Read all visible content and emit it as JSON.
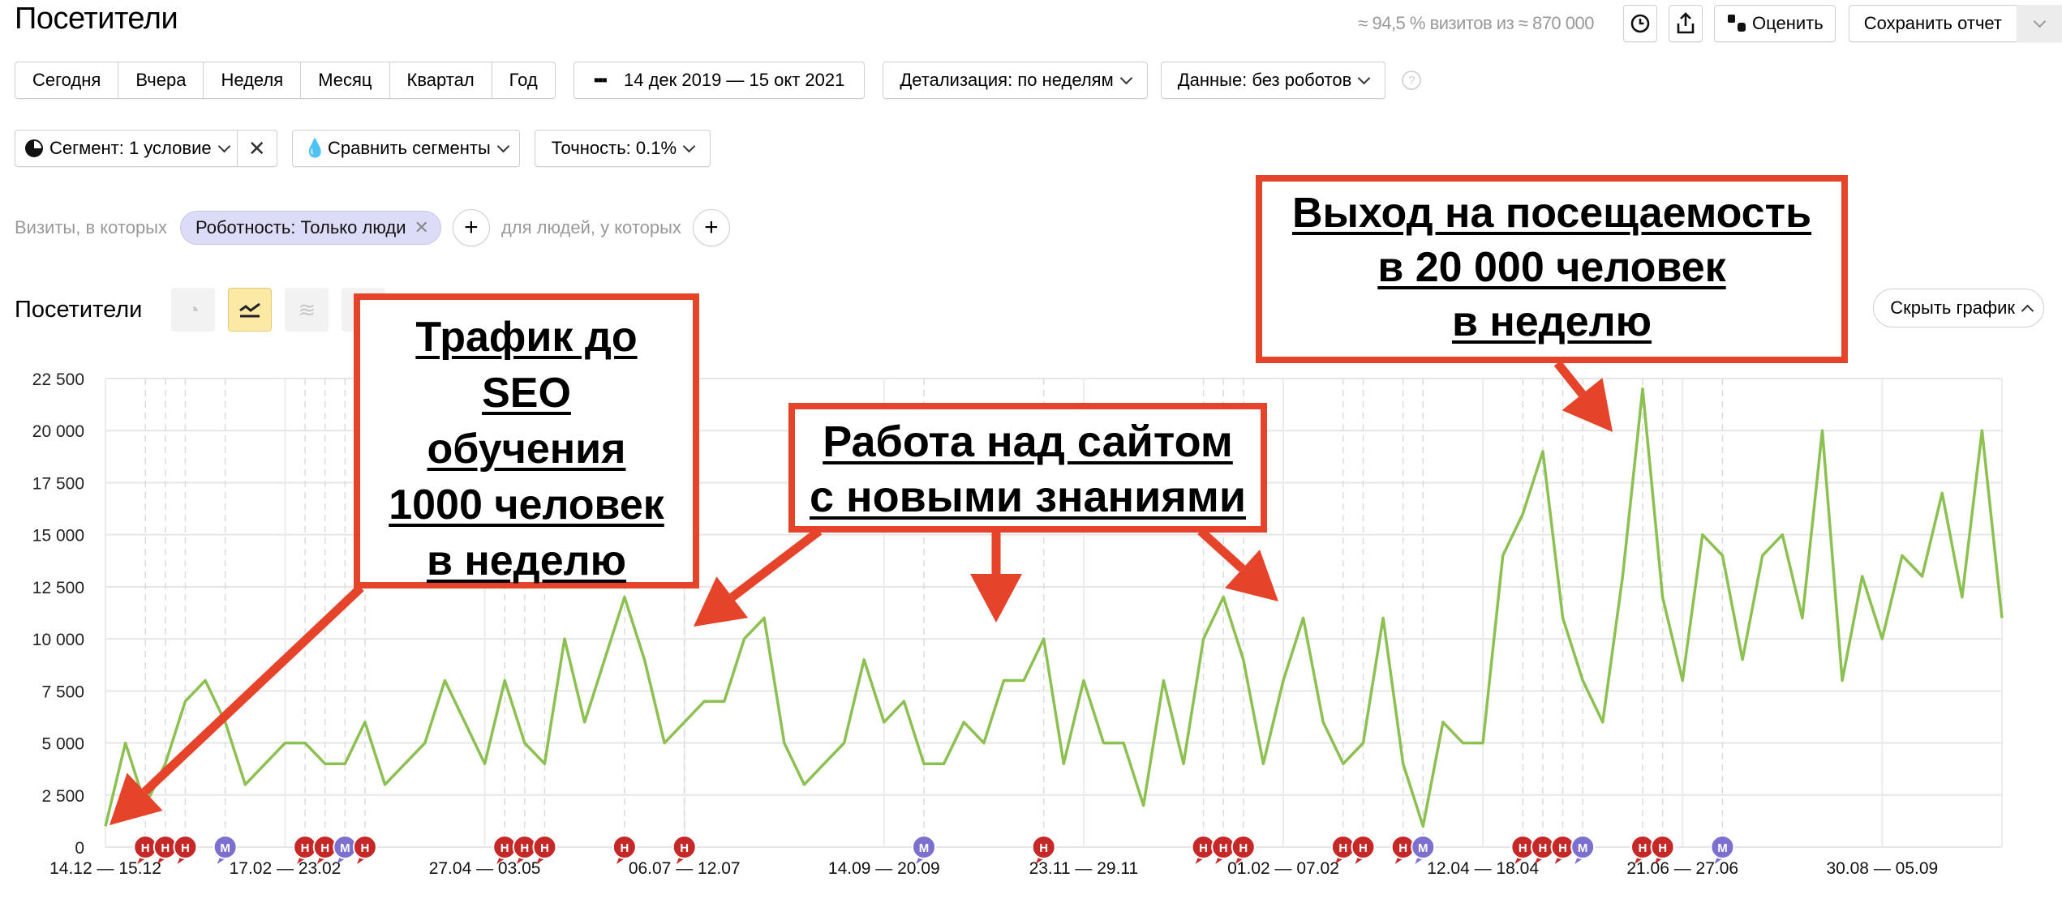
{
  "header": {
    "title": "Посетители",
    "sampling_text": "≈ 94,5 % визитов из ≈ 870 000",
    "rate_label": "Оценить",
    "save_label": "Сохранить отчет"
  },
  "periods": [
    "Сегодня",
    "Вчера",
    "Неделя",
    "Месяц",
    "Квартал",
    "Год"
  ],
  "date_range": "14 дек 2019 — 15 окт 2021",
  "detail_label": "Детализация: по неделям",
  "data_label": "Данные: без роботов",
  "segment": {
    "label": "Сегмент: 1 условие",
    "compare_label": "Сравнить сегменты",
    "accuracy_label": "Точность: 0.1%"
  },
  "filters": {
    "visits_prefix": "Визиты, в которых",
    "chip_label": "Роботность: Только люди",
    "people_prefix": "для людей, у которых"
  },
  "chart_section": {
    "title": "Посетители",
    "hide_label": "Скрыть график"
  },
  "annotations": [
    {
      "lines": [
        "Трафик до",
        "SEO",
        "обучения",
        "1000 человек",
        "в неделю"
      ]
    },
    {
      "lines": [
        "Работа над сайтом",
        "с новыми знаниями"
      ]
    },
    {
      "lines": [
        "Выход на посещаемость",
        "в 20 000 человек",
        "в неделю"
      ]
    }
  ],
  "colors": {
    "line": "#8cc152",
    "annotation": "#e5432a",
    "marker_h": "#c62828",
    "marker_m": "#7b6fcf"
  },
  "chart_data": {
    "type": "line",
    "title": "Посетители",
    "xlabel": "",
    "ylabel": "",
    "ylim": [
      0,
      22500
    ],
    "yticks": [
      0,
      2500,
      5000,
      7500,
      10000,
      12500,
      15000,
      17500,
      20000,
      22500
    ],
    "ytick_labels": [
      "0",
      "2 500",
      "5 000",
      "7 500",
      "10 000",
      "12 500",
      "15 000",
      "17 500",
      "20 000",
      "22 500"
    ],
    "x_tick_labels": [
      {
        "index": 0,
        "label": "14.12 — 15.12"
      },
      {
        "index": 9,
        "label": "17.02 — 23.02"
      },
      {
        "index": 19,
        "label": "27.04 — 03.05"
      },
      {
        "index": 29,
        "label": "06.07 — 12.07"
      },
      {
        "index": 39,
        "label": "14.09 — 20.09"
      },
      {
        "index": 49,
        "label": "23.11 — 29.11"
      },
      {
        "index": 59,
        "label": "01.02 — 07.02"
      },
      {
        "index": 69,
        "label": "12.04 — 18.04"
      },
      {
        "index": 79,
        "label": "21.06 — 27.06"
      },
      {
        "index": 89,
        "label": "30.08 — 05.09"
      }
    ],
    "grid": true,
    "legend": "none",
    "series": [
      {
        "name": "Посетители",
        "values": [
          1000,
          5000,
          2000,
          4000,
          7000,
          8000,
          6000,
          3000,
          4000,
          5000,
          5000,
          4000,
          4000,
          6000,
          3000,
          4000,
          5000,
          8000,
          6000,
          4000,
          8000,
          5000,
          4000,
          10000,
          6000,
          9000,
          12000,
          9000,
          5000,
          6000,
          7000,
          7000,
          10000,
          11000,
          5000,
          3000,
          4000,
          5000,
          9000,
          6000,
          7000,
          4000,
          4000,
          6000,
          5000,
          8000,
          8000,
          10000,
          4000,
          8000,
          5000,
          5000,
          2000,
          8000,
          4000,
          10000,
          12000,
          9000,
          4000,
          8000,
          11000,
          6000,
          4000,
          5000,
          11000,
          4000,
          1000,
          6000,
          5000,
          5000,
          14000,
          16000,
          19000,
          11000,
          8000,
          6000,
          13000,
          22000,
          12000,
          8000,
          15000,
          14000,
          9000,
          14000,
          15000,
          11000,
          20000,
          8000,
          13000,
          10000,
          14000,
          13000,
          17000,
          12000,
          20000,
          11000
        ]
      }
    ],
    "event_markers": [
      {
        "index": 2,
        "type": "Н"
      },
      {
        "index": 3,
        "type": "Н"
      },
      {
        "index": 4,
        "type": "Н"
      },
      {
        "index": 6,
        "type": "М"
      },
      {
        "index": 10,
        "type": "Н"
      },
      {
        "index": 11,
        "type": "Н"
      },
      {
        "index": 12,
        "type": "М"
      },
      {
        "index": 13,
        "type": "Н"
      },
      {
        "index": 20,
        "type": "Н"
      },
      {
        "index": 21,
        "type": "Н"
      },
      {
        "index": 22,
        "type": "Н"
      },
      {
        "index": 26,
        "type": "Н"
      },
      {
        "index": 29,
        "type": "Н"
      },
      {
        "index": 41,
        "type": "М"
      },
      {
        "index": 47,
        "type": "Н"
      },
      {
        "index": 55,
        "type": "Н"
      },
      {
        "index": 56,
        "type": "Н"
      },
      {
        "index": 57,
        "type": "Н"
      },
      {
        "index": 62,
        "type": "Н"
      },
      {
        "index": 63,
        "type": "Н"
      },
      {
        "index": 65,
        "type": "Н"
      },
      {
        "index": 66,
        "type": "М"
      },
      {
        "index": 71,
        "type": "Н"
      },
      {
        "index": 72,
        "type": "Н"
      },
      {
        "index": 73,
        "type": "Н"
      },
      {
        "index": 74,
        "type": "М"
      },
      {
        "index": 77,
        "type": "Н"
      },
      {
        "index": 78,
        "type": "Н"
      },
      {
        "index": 81,
        "type": "М"
      }
    ]
  }
}
